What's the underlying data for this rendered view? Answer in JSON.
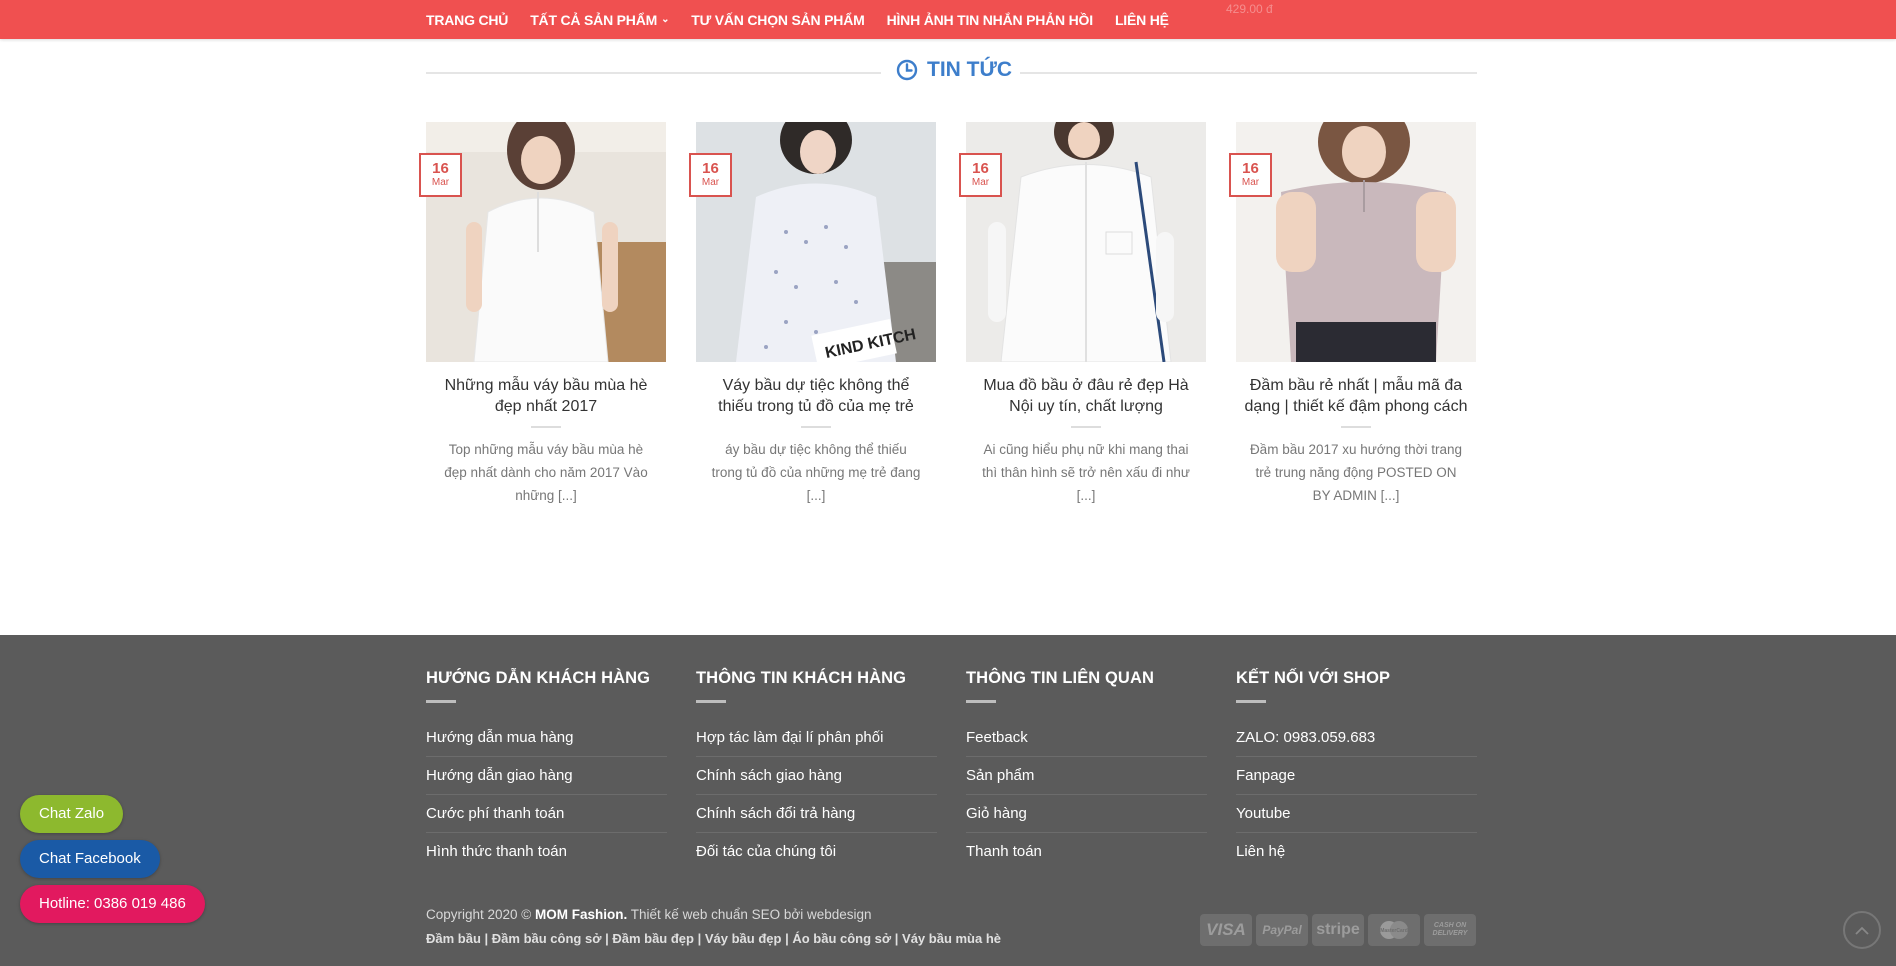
{
  "nav": {
    "items": [
      {
        "label": "TRANG CHỦ"
      },
      {
        "label": "TẤT CẢ SẢN PHẨM"
      },
      {
        "label": "TƯ VẤN CHỌN SẢN PHẨM"
      },
      {
        "label": "HÌNH ẢNH TIN NHẮN PHẢN HỒI"
      },
      {
        "label": "LIÊN HỆ"
      }
    ],
    "ghost_price": "429.00 đ"
  },
  "news": {
    "title": "TIN TỨC",
    "posts": [
      {
        "day": "16",
        "month": "Mar",
        "title": "Những mẫu váy bầu mùa hè đẹp nhất 2017",
        "excerpt": "Top những mẫu váy bầu mùa hè đẹp nhất dành cho năm 2017 Vào những [...]"
      },
      {
        "day": "16",
        "month": "Mar",
        "title": "Váy bầu dự tiệc không thể thiếu trong tủ đồ của mẹ trẻ",
        "excerpt": "áy bầu dự tiệc không thể thiếu trong tủ đồ của những mẹ trẻ đang [...]"
      },
      {
        "day": "16",
        "month": "Mar",
        "title": "Mua đồ bầu ở đâu rẻ đẹp Hà Nội uy tín, chất lượng",
        "excerpt": "Ai cũng hiểu phụ nữ khi mang thai thì thân hình sẽ trở nên xấu đi như [...]"
      },
      {
        "day": "16",
        "month": "Mar",
        "title": "Đầm bầu rẻ nhất | mẫu mã đa dạng | thiết kế đậm phong cách",
        "excerpt": "Đầm bầu 2017 xu hướng thời trang trẻ trung năng động POSTED ON BY ADMIN [...]"
      }
    ]
  },
  "footer": {
    "columns": [
      {
        "title": "HƯỚNG DẪN KHÁCH HÀNG",
        "links": [
          "Hướng dẫn mua hàng",
          "Hướng dẫn giao hàng",
          "Cước phí thanh toán",
          "Hình thức thanh toán"
        ]
      },
      {
        "title": "THÔNG TIN KHÁCH HÀNG",
        "links": [
          "Hợp tác làm đại lí phân phối",
          "Chính sách giao hàng",
          "Chính sách đổi trả hàng",
          "Đối tác của chúng tôi"
        ]
      },
      {
        "title": "THÔNG TIN LIÊN QUAN",
        "links": [
          "Feetback",
          "Sản phẩm",
          "Giỏ hàng",
          "Thanh toán"
        ]
      },
      {
        "title": "KẾT NỐI VỚI SHOP",
        "links": [
          "ZALO: 0983.059.683",
          "Fanpage",
          "Youtube",
          "Liên hệ"
        ]
      }
    ],
    "copyright_prefix": "Copyright 2020 ©",
    "brand": "MOM Fashion.",
    "copyright_suffix": "Thiết kế web chuẩn SEO bởi webdesign",
    "tags": [
      "Đầm bầu",
      "Đầm bầu công sở",
      "Đầm bầu đẹp",
      "Váy bầu đẹp",
      "Áo bầu công sở",
      "Váy bầu mùa hè"
    ],
    "tag_separator": "|",
    "payments": [
      "VISA",
      "PayPal",
      "stripe",
      "MasterCard",
      "CASH ON DELIVERY"
    ]
  },
  "chat": {
    "zalo": "Chat Zalo",
    "facebook": "Chat Facebook",
    "hotline": "Hotline: 0386 019 486"
  },
  "colors": {
    "nav_bg": "#f05050",
    "accent_blue": "#3d7ecb",
    "date_red": "#d9534f",
    "footer_bg": "#5b5b5b",
    "zalo": "#8db92e",
    "facebook": "#1a5aa6",
    "hotline": "#e2195f"
  }
}
